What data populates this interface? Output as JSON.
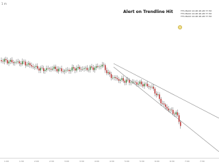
{
  "header": {
    "ticker_text": "1 m"
  },
  "chart": {
    "title": "Alert on Trendline Hit",
    "alerts": [
      "TTS MACD 10:48 48 AM 77 Hit",
      "TTS MACD 10:48 48 AM 77 Hit",
      "TTS MACD 10:48 48 AM 77 Hit"
    ]
  },
  "x_axis": {
    "labels": [
      "1:00",
      "1:30",
      "2:00",
      "2:30",
      "3:00",
      "3:30",
      "4:00",
      "4:30",
      "5:00",
      "5:30",
      "6:00",
      "6:30",
      "7:00",
      "7:30"
    ]
  }
}
